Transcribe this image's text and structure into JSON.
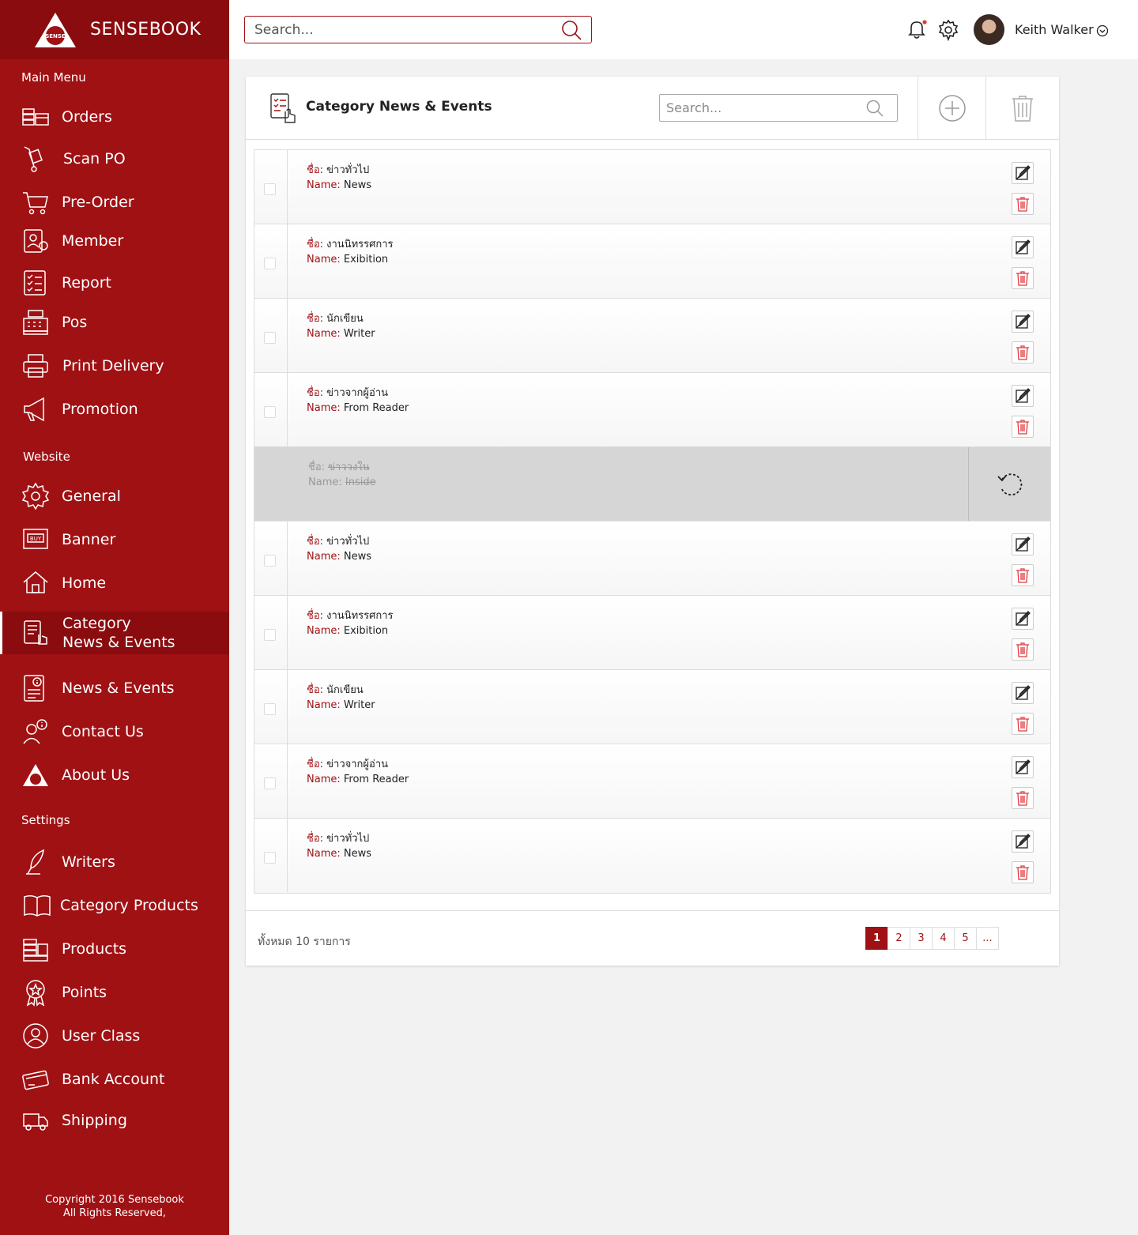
{
  "brand": {
    "name": "SENSEBOOK",
    "logo_text": "SENSE"
  },
  "sidebar": {
    "sections": {
      "main": "Main Menu",
      "website": "Website",
      "settings": "Settings"
    },
    "main_items": [
      {
        "label": "Orders",
        "icon": "orders-icon"
      },
      {
        "label": "Scan PO",
        "icon": "hand-truck-icon"
      },
      {
        "label": "Pre-Order",
        "icon": "cart-icon"
      },
      {
        "label": "Member",
        "icon": "member-icon"
      },
      {
        "label": "Report",
        "icon": "report-icon"
      },
      {
        "label": "Pos",
        "icon": "cash-register-icon"
      },
      {
        "label": "Print Delivery",
        "icon": "printer-icon"
      },
      {
        "label": "Promotion",
        "icon": "megaphone-icon"
      }
    ],
    "website_items": [
      {
        "label": "General",
        "icon": "gear-icon"
      },
      {
        "label": "Banner",
        "icon": "banner-icon"
      },
      {
        "label": "Home",
        "icon": "home-icon"
      },
      {
        "label": "Category\nNews & Events",
        "icon": "category-icon",
        "active": true
      },
      {
        "label": "News & Events",
        "icon": "news-icon"
      },
      {
        "label": "Contact Us",
        "icon": "contact-icon"
      },
      {
        "label": "About Us",
        "icon": "logo-icon"
      }
    ],
    "settings_items": [
      {
        "label": "Writers",
        "icon": "quill-icon"
      },
      {
        "label": "Category Products",
        "icon": "open-book-icon"
      },
      {
        "label": "Products",
        "icon": "books-icon"
      },
      {
        "label": "Points",
        "icon": "award-icon"
      },
      {
        "label": "User Class",
        "icon": "user-class-icon"
      },
      {
        "label": "Bank Account",
        "icon": "bank-card-icon"
      },
      {
        "label": "Shipping",
        "icon": "truck-icon"
      }
    ],
    "copyright_line1": "Copyright 2016 Sensebook",
    "copyright_line2": "All Rights Reserved,"
  },
  "topbar": {
    "search_placeholder": "Search...",
    "username": "Keith Walker",
    "notification_dot_color": "#e53935"
  },
  "panel": {
    "title": "Category News & Events",
    "search_placeholder": "Search...",
    "rows": [
      {
        "th_label": "ชื่อ:",
        "th_value": "ข่าวทั่วไป",
        "en_label": "Name:",
        "en_value": "News",
        "deleted": false
      },
      {
        "th_label": "ชื่อ:",
        "th_value": "งานนิทรรศการ",
        "en_label": "Name:",
        "en_value": "Exibition",
        "deleted": false
      },
      {
        "th_label": "ชื่อ:",
        "th_value": "นักเขียน",
        "en_label": "Name:",
        "en_value": "Writer",
        "deleted": false
      },
      {
        "th_label": "ชื่อ:",
        "th_value": "ข่าวจากผู้อ่าน",
        "en_label": "Name:",
        "en_value": "From Reader",
        "deleted": false
      },
      {
        "th_label": "ชื่อ:",
        "th_value": "ข่าววงใน",
        "en_label": "Name:",
        "en_value": "Inside",
        "deleted": true
      },
      {
        "th_label": "ชื่อ:",
        "th_value": "ข่าวทั่วไป",
        "en_label": "Name:",
        "en_value": "News",
        "deleted": false
      },
      {
        "th_label": "ชื่อ:",
        "th_value": "งานนิทรรศการ",
        "en_label": "Name:",
        "en_value": "Exibition",
        "deleted": false
      },
      {
        "th_label": "ชื่อ:",
        "th_value": "นักเขียน",
        "en_label": "Name:",
        "en_value": "Writer",
        "deleted": false
      },
      {
        "th_label": "ชื่อ:",
        "th_value": "ข่าวจากผู้อ่าน",
        "en_label": "Name:",
        "en_value": "From Reader",
        "deleted": false
      },
      {
        "th_label": "ชื่อ:",
        "th_value": "ข่าวทั่วไป",
        "en_label": "Name:",
        "en_value": "News",
        "deleted": false
      }
    ],
    "total_text": "ทั้งหมด 10 รายการ",
    "pages": [
      "1",
      "2",
      "3",
      "4",
      "5",
      "..."
    ],
    "current_page": "1"
  },
  "colors": {
    "brand": "#a01114",
    "brand_dark": "#8a0c0f"
  }
}
